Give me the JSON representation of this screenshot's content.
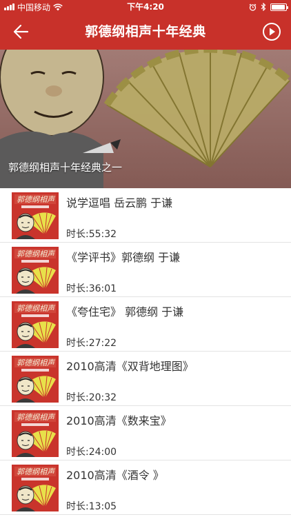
{
  "status_bar": {
    "carrier": "中国移动",
    "time": "下午4:20",
    "battery_level": 0.95
  },
  "nav": {
    "title": "郭德纲相声十年经典",
    "back_icon": "back-arrow-icon",
    "play_icon": "play-circle-icon"
  },
  "banner": {
    "caption": "郭德纲相声十年经典之一"
  },
  "items": [
    {
      "title": "说学逗唱 岳云鹏 于谦",
      "duration": "时长:55:32"
    },
    {
      "title": "《学评书》郭德纲 于谦",
      "duration": "时长:36:01"
    },
    {
      "title": "《夸住宅》 郭德纲 于谦",
      "duration": "时长:27:22"
    },
    {
      "title": "2010高清《双背地理图》",
      "duration": "时长:20:32"
    },
    {
      "title": "2010高清《数来宝》",
      "duration": "时长:24:00"
    },
    {
      "title": "2010高清《酒令 》",
      "duration": "时长:13:05"
    }
  ],
  "colors": {
    "brand_red": "#c8312a",
    "fan_yellow": "#e8e04a"
  }
}
